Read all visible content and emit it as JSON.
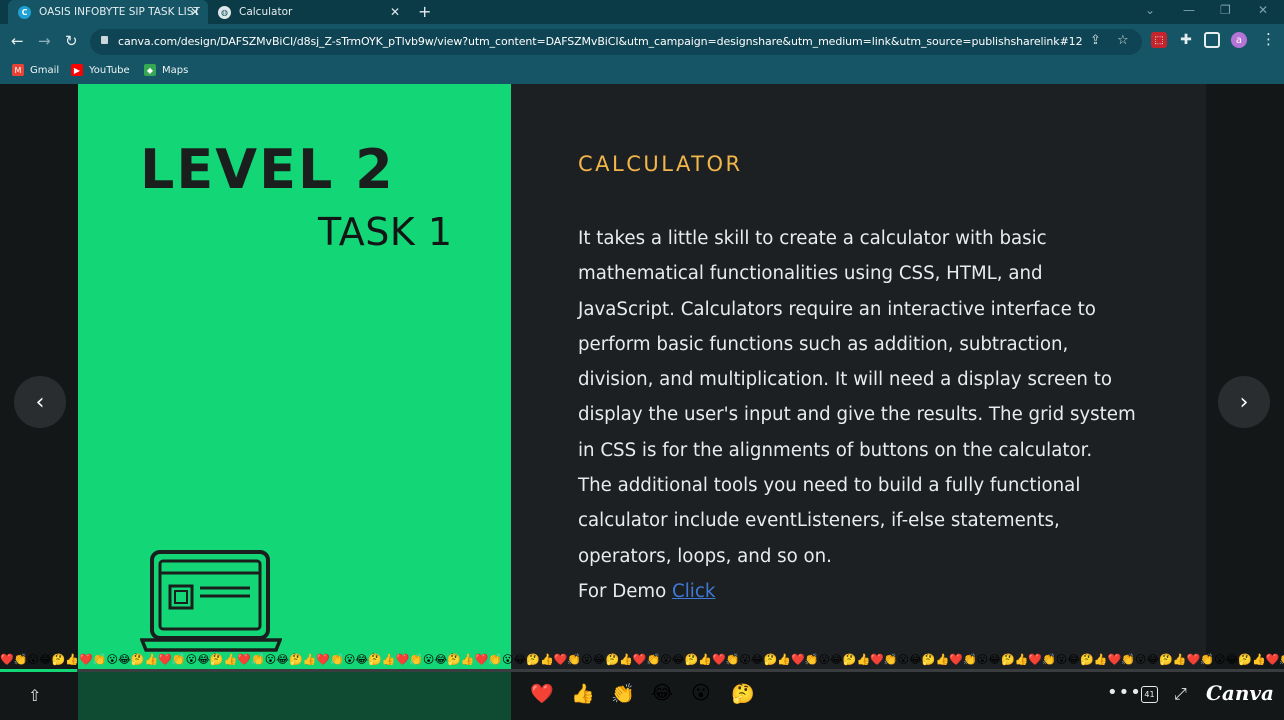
{
  "browser": {
    "tabs": [
      {
        "title": "OASIS INFOBYTE SIP TASK LIST",
        "favicon": "canva-icon",
        "active": true
      },
      {
        "title": "Calculator",
        "favicon": "globe-icon",
        "active": false
      }
    ],
    "url": "canva.com/design/DAFSZMvBiCI/d8sj_Z-sTrmOYK_pTlvb9w/view?utm_content=DAFSZMvBiCI&utm_campaign=designshare&utm_medium=link&utm_source=publishsharelink#12",
    "bookmarks": [
      {
        "label": "Gmail"
      },
      {
        "label": "YouTube"
      },
      {
        "label": "Maps"
      }
    ],
    "profile_initial": "a",
    "colors": {
      "tabstrip": "#0c3b48",
      "toolbar": "#165566"
    }
  },
  "slide": {
    "level": "LEVEL 2",
    "task": "TASK 1",
    "title": "CALCULATOR",
    "body_lines": [
      "It takes a little skill to create a calculator with basic",
      "mathematical functionalities using CSS, HTML, and",
      "JavaScript. Calculators require an interactive interface to",
      "perform basic functions such as addition, subtraction,",
      "division, and multiplication. It will need a  display screen to",
      "display the user's input and give the results. The grid system",
      "in CSS is for the alignments of buttons on the calculator.",
      "The additional tools you need to build a fully functional",
      "calculator include eventListeners, if-else statements,",
      "operators, loops, and so on."
    ],
    "demo_prefix": "For Demo ",
    "demo_link": "Click ",
    "colors": {
      "left_panel": "#13d677",
      "right_panel": "#1d2022",
      "title": "#f2b64a",
      "link": "#3e7ad8"
    }
  },
  "viewer": {
    "progress": 0.06,
    "reactions": [
      "❤️",
      "👍",
      "👏",
      "😂",
      "😮",
      "🤔"
    ],
    "page_count": "41",
    "brand": "Canva"
  }
}
